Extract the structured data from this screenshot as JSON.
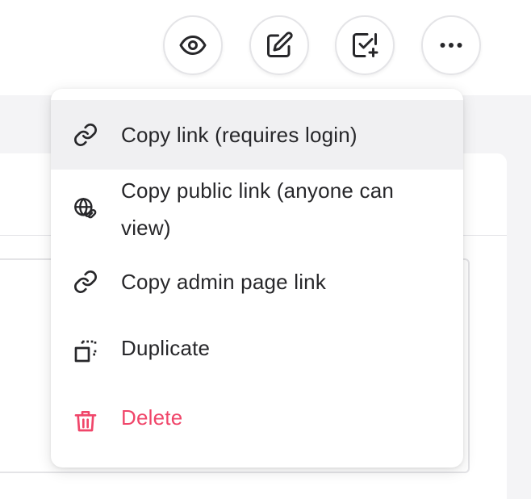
{
  "toolbar": {
    "buttons": [
      {
        "name": "preview",
        "icon": "eye-icon"
      },
      {
        "name": "edit",
        "icon": "pencil-square-icon"
      },
      {
        "name": "approve",
        "icon": "checkbox-plus-icon"
      },
      {
        "name": "more",
        "icon": "ellipsis-icon"
      }
    ]
  },
  "menu": {
    "items": [
      {
        "label": "Copy link (requires login)",
        "icon": "link-icon",
        "active": true
      },
      {
        "label": "Copy public link (anyone can view)",
        "icon": "globe-link-icon"
      },
      {
        "label": "Copy admin page link",
        "icon": "link-icon"
      },
      {
        "label": "Duplicate",
        "icon": "duplicate-icon"
      },
      {
        "label": "Delete",
        "icon": "trash-icon",
        "danger": true
      }
    ]
  },
  "colors": {
    "text": "#27272a",
    "danger": "#f0466a",
    "hover_bg": "#f0f0f2",
    "page_bg": "#f4f4f6"
  }
}
